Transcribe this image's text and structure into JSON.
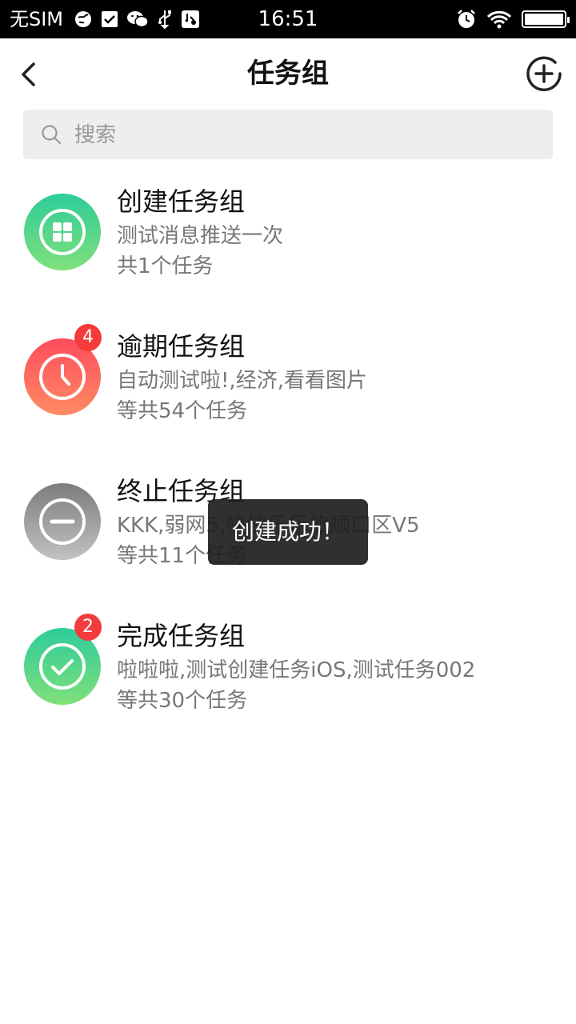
{
  "status_bar": {
    "carrier": "无SIM",
    "time": "16:51",
    "icons_left": [
      "globe-icon",
      "check-square-icon",
      "wechat-icon",
      "usb-icon",
      "usb-debug-icon"
    ],
    "icons_right": [
      "alarm-icon",
      "wifi-icon",
      "battery-icon"
    ],
    "battery_level": 1.0
  },
  "nav": {
    "title": "任务组",
    "back_icon": "chevron-left-icon",
    "add_icon": "plus-circle-icon"
  },
  "search": {
    "placeholder": "搜索",
    "value": ""
  },
  "groups": [
    {
      "title": "创建任务组",
      "subtitle": "测试消息推送一次",
      "count": "共1个任务",
      "icon": "grid-icon",
      "color": "green",
      "badge": ""
    },
    {
      "title": "逾期任务组",
      "subtitle": "自动测试啦!,经济,看看图片",
      "count": "等共54个任务",
      "icon": "clock-icon",
      "color": "red",
      "badge": "4"
    },
    {
      "title": "终止任务组",
      "subtitle": "KKK,弱网5,快快乐乐旅顺口区V5",
      "count": "等共11个任务",
      "icon": "minus-circle-icon",
      "color": "gray",
      "badge": ""
    },
    {
      "title": "完成任务组",
      "subtitle": "啦啦啦,测试创建任务iOS,测试任务002",
      "count": "等共30个任务",
      "icon": "check-circle-icon",
      "color": "green",
      "badge": "2"
    }
  ],
  "toast": {
    "text": "创建成功！"
  },
  "colors": {
    "badge": "#f43a3a",
    "green_top": "#2ecc9a",
    "red_top": "#fd4c5e",
    "gray_top": "#7c7c7c"
  }
}
